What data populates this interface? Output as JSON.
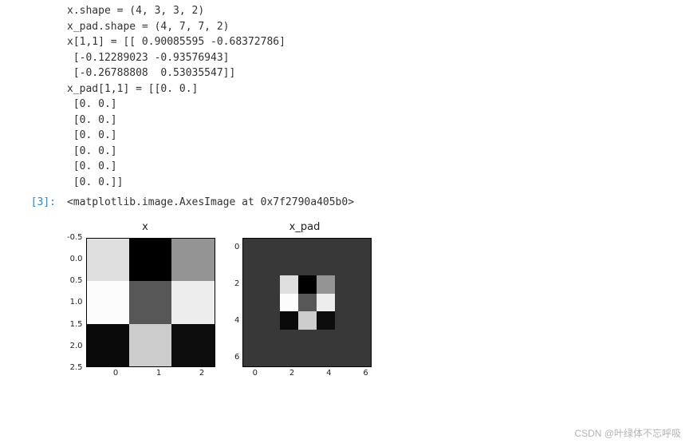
{
  "output_text": "x.shape = (4, 3, 3, 2)\nx_pad.shape = (4, 7, 7, 2)\nx[1,1] = [[ 0.90085595 -0.68372786]\n [-0.12289023 -0.93576943]\n [-0.26788808  0.53035547]]\nx_pad[1,1] = [[0. 0.]\n [0. 0.]\n [0. 0.]\n [0. 0.]\n [0. 0.]\n [0. 0.]\n [0. 0.]]",
  "prompt": "[3]:",
  "repr": "<matplotlib.image.AxesImage at 0x7f2790a405b0>",
  "watermark": "CSDN @叶绿体不忘呼吸",
  "chart_data": [
    {
      "type": "heatmap",
      "title": "x",
      "xlabel": "",
      "ylabel": "",
      "x_ticks": [
        "0",
        "1",
        "2"
      ],
      "y_ticks": [
        "-0.5",
        "0.0",
        "0.5",
        "1.0",
        "1.5",
        "2.0",
        "2.5"
      ],
      "rows": 3,
      "cols": 3,
      "values": [
        [
          0.87,
          0.0,
          0.58
        ],
        [
          0.99,
          0.34,
          0.93
        ],
        [
          0.04,
          0.8,
          0.05
        ]
      ],
      "colormap": "gray",
      "vmin": 0.0,
      "vmax": 1.0
    },
    {
      "type": "heatmap",
      "title": "x_pad",
      "xlabel": "",
      "ylabel": "",
      "x_ticks": [
        "0",
        "2",
        "4",
        "6"
      ],
      "y_ticks": [
        "0",
        "2",
        "4",
        "6"
      ],
      "rows": 7,
      "cols": 7,
      "values": [
        [
          0.22,
          0.22,
          0.22,
          0.22,
          0.22,
          0.22,
          0.22
        ],
        [
          0.22,
          0.22,
          0.22,
          0.22,
          0.22,
          0.22,
          0.22
        ],
        [
          0.22,
          0.22,
          0.87,
          0.0,
          0.58,
          0.22,
          0.22
        ],
        [
          0.22,
          0.22,
          0.99,
          0.34,
          0.93,
          0.22,
          0.22
        ],
        [
          0.22,
          0.22,
          0.04,
          0.8,
          0.05,
          0.22,
          0.22
        ],
        [
          0.22,
          0.22,
          0.22,
          0.22,
          0.22,
          0.22,
          0.22
        ],
        [
          0.22,
          0.22,
          0.22,
          0.22,
          0.22,
          0.22,
          0.22
        ]
      ],
      "colormap": "gray",
      "vmin": 0.0,
      "vmax": 1.0
    }
  ]
}
